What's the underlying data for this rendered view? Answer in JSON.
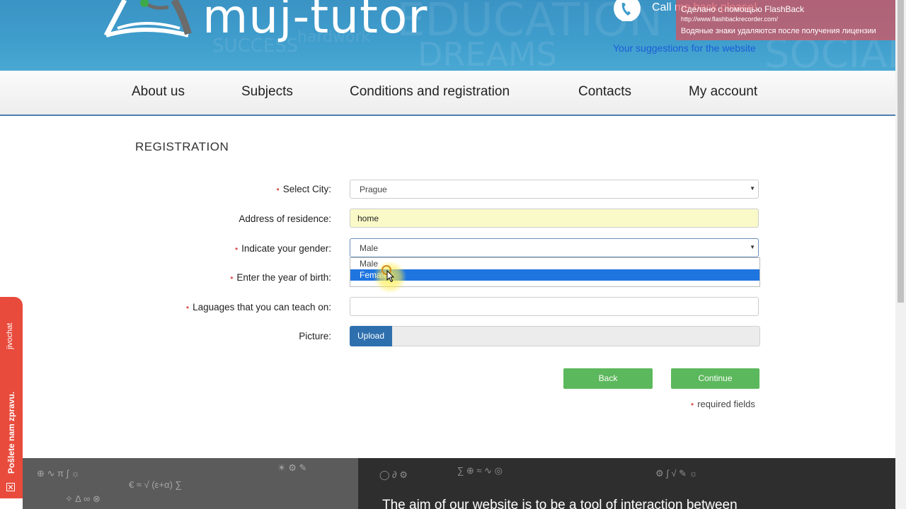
{
  "header": {
    "logo_text": "muj-tutor",
    "call_text": "Call me back please!",
    "suggestions_link": "Your suggestions for the website",
    "watermark": {
      "line1": "Сделано с помощью FlashBack",
      "line2": "http://www.flashbackrecorder.com/",
      "line3": "Водяные знаки удаляются после получения лицензии"
    }
  },
  "nav": {
    "items": [
      "About us",
      "Subjects",
      "Conditions and registration",
      "Contacts",
      "My account"
    ]
  },
  "form": {
    "title": "REGISTRATION",
    "city_label": "Select City:",
    "city_value": "Prague",
    "address_label": "Address of residence:",
    "address_value": "home",
    "gender_label": "Indicate your gender:",
    "gender_value": "Male",
    "gender_options": [
      "Male",
      "Female"
    ],
    "gender_highlighted": "Female",
    "birth_label": "Enter the year of birth:",
    "languages_label": "Laguages that you can teach on:",
    "languages_value": "",
    "picture_label": "Picture:",
    "upload_label": "Upload",
    "back_label": "Back",
    "continue_label": "Continue",
    "required_note": "required fields",
    "required_marker": "•"
  },
  "chat_tab": {
    "brand": "jivochat",
    "message": "Pošlete nam zpravu.",
    "close_symbol": "✕"
  },
  "footer": {
    "text": "The aim of our website is to be a tool of interaction between"
  },
  "colors": {
    "banner": "#3f9dcc",
    "nav_border": "#4d7fae",
    "highlight": "#1f75e0",
    "green_button": "#5cb85c",
    "upload_button": "#2e6fae",
    "chat_tab": "#e84b3c"
  }
}
